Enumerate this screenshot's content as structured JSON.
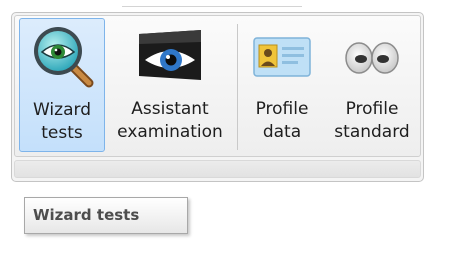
{
  "ribbon": {
    "buttons": [
      {
        "label": "Wizard\ntests",
        "icon": "magnifier-eye-icon",
        "selected": true
      },
      {
        "label": "Assistant\nexamination",
        "icon": "eye-camera-icon",
        "selected": false
      },
      {
        "label": "Profile\ndata",
        "icon": "id-card-icon",
        "selected": false
      },
      {
        "label": "Profile\nstandard",
        "icon": "eyes-icon",
        "selected": false
      }
    ]
  },
  "tooltip": {
    "text": "Wizard tests"
  },
  "colors": {
    "selection": "#c4e0fb",
    "selection_border": "#7eb4ea",
    "panel": "#f4f4f4"
  }
}
